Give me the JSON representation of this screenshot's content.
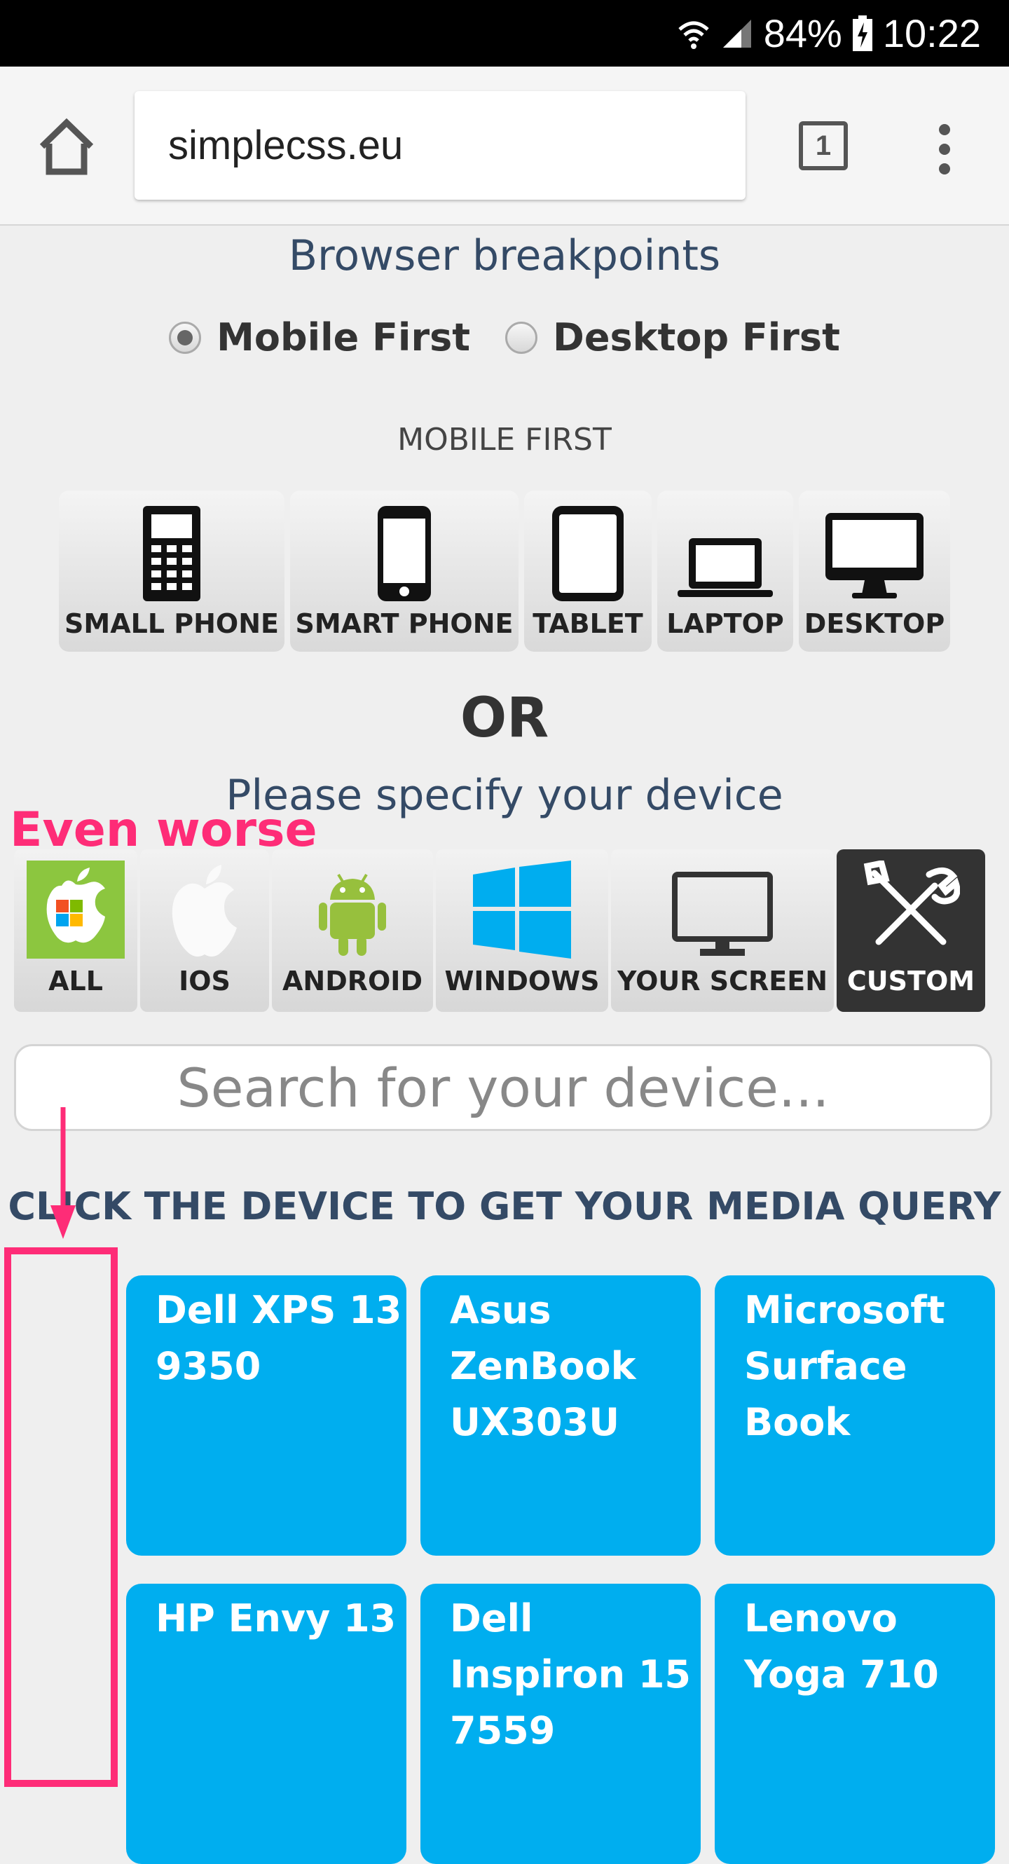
{
  "status_bar": {
    "battery": "84%",
    "time": "10:22"
  },
  "browser": {
    "url": "simplecss.eu",
    "tab_count": "1"
  },
  "page": {
    "heading": "Browser breakpoints",
    "radio_options": [
      {
        "label": "Mobile First",
        "selected": true
      },
      {
        "label": "Desktop First",
        "selected": false
      }
    ],
    "mode_label": "MOBILE FIRST",
    "breakpoints": [
      {
        "label": "SMALL PHONE",
        "icon": "feature-phone-icon"
      },
      {
        "label": "SMART PHONE",
        "icon": "smartphone-icon"
      },
      {
        "label": "TABLET",
        "icon": "tablet-icon"
      },
      {
        "label": "LAPTOP",
        "icon": "laptop-icon"
      },
      {
        "label": "DESKTOP",
        "icon": "desktop-monitor-icon"
      }
    ],
    "or_text": "OR",
    "specify_text": "Please specify your device",
    "os_filters": [
      {
        "label": "ALL",
        "icon": "all-platforms-icon"
      },
      {
        "label": "IOS",
        "icon": "apple-icon"
      },
      {
        "label": "ANDROID",
        "icon": "android-icon"
      },
      {
        "label": "WINDOWS",
        "icon": "windows-icon"
      },
      {
        "label": "YOUR SCREEN",
        "icon": "monitor-icon"
      },
      {
        "label": "CUSTOM",
        "icon": "tools-icon",
        "active": true
      }
    ],
    "search_placeholder": "Search for your device...",
    "instruction": "CLICK THE DEVICE TO GET YOUR MEDIA QUERY",
    "devices": [
      "Dell XPS 13 9350",
      "Asus ZenBook UX303U",
      "Microsoft Surface Book",
      "HP Envy 13",
      "Dell Inspiron 15 7559",
      "Lenovo Yoga 710"
    ]
  },
  "annotation": {
    "text": "Even worse",
    "color": "#fe2c77"
  },
  "colors": {
    "card": "#00aeef",
    "heading": "#344a66",
    "active_filter": "#333333"
  }
}
